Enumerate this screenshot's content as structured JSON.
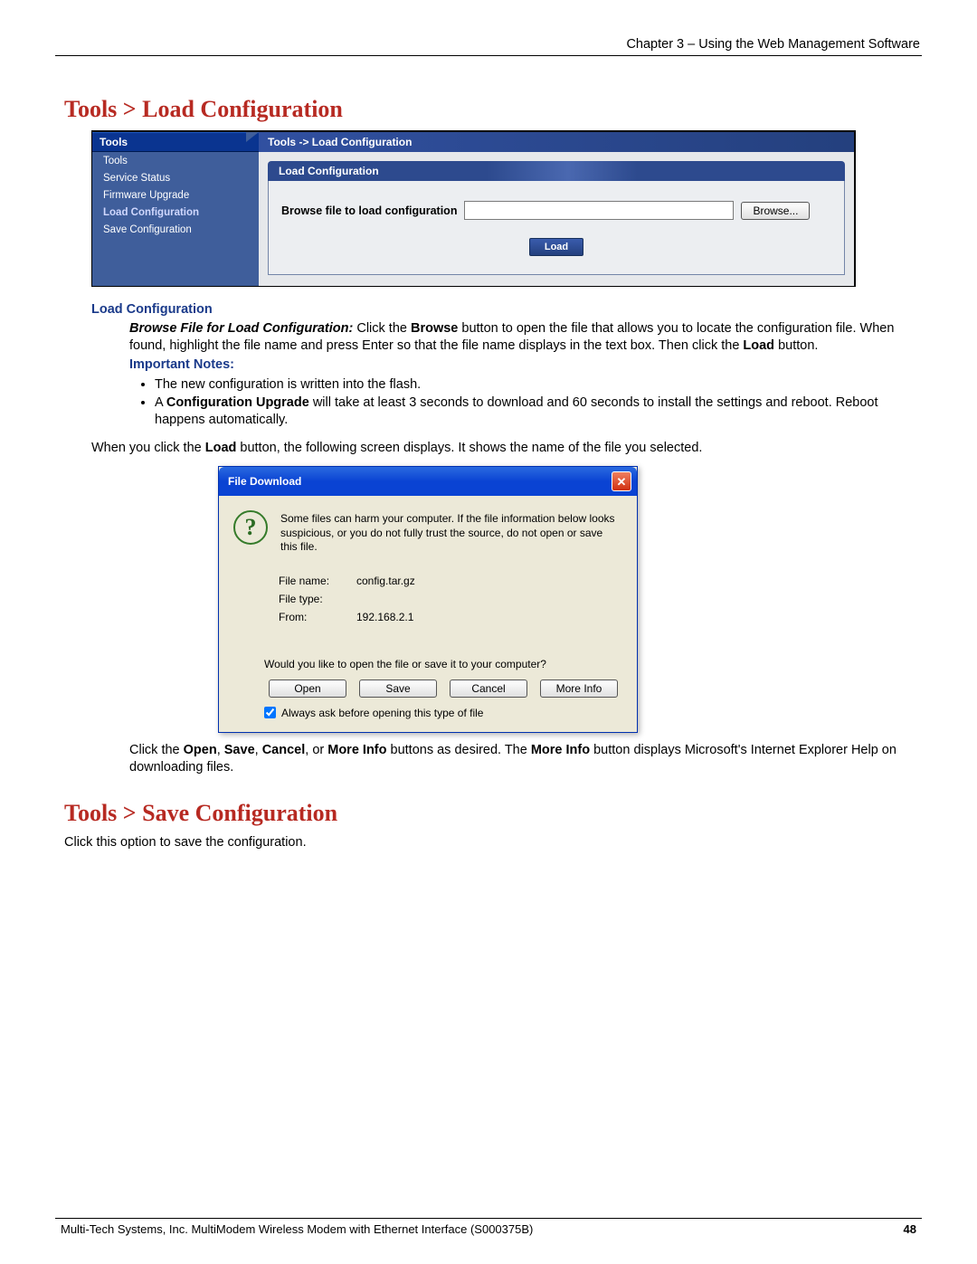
{
  "header": {
    "chapter": "Chapter 3 – Using the Web Management Software"
  },
  "section1": {
    "heading": "Tools > Load Configuration"
  },
  "webui": {
    "sidebar": {
      "tab": "Tools",
      "items": [
        "Tools",
        "Service Status",
        "Firmware Upgrade",
        "Load Configuration",
        "Save Configuration"
      ],
      "active_index": 3
    },
    "crumb": "Tools  ->  Load Configuration",
    "section_title": "Load Configuration",
    "browse_label": "Browse file to load configuration",
    "browse_btn": "Browse...",
    "load_btn": "Load"
  },
  "doc1": {
    "sub1": "Load Configuration",
    "p1_lead": "Browse File for Load Configuration:",
    "p1_rest_a": " Click the ",
    "p1_browse": "Browse",
    "p1_rest_b": " button to open the file that allows you to locate the configuration file. When found, highlight the file name and press Enter so that the file name displays in the text box. Then click the ",
    "p1_load": "Load",
    "p1_rest_c": " button.",
    "sub2": "Important Notes:",
    "bullets": {
      "b1": "The new configuration is written into the flash.",
      "b2_a": "A ",
      "b2_b": "Configuration Upgrade",
      "b2_c": " will take at least 3 seconds to download and 60 seconds to install the settings and reboot. Reboot happens automatically."
    },
    "after_a": "When you click the ",
    "after_load": "Load",
    "after_b": " button, the following screen displays. It shows the name of the file you selected."
  },
  "dialog": {
    "title": "File Download",
    "msg": "Some files can harm your computer. If the file information below looks suspicious, or you do not fully trust the source, do not open or save this file.",
    "filename_lbl": "File name:",
    "filename": "config.tar.gz",
    "filetype_lbl": "File type:",
    "filetype": "",
    "from_lbl": "From:",
    "from": "192.168.2.1",
    "question": "Would you like to open the file or save it to your computer?",
    "btn_open": "Open",
    "btn_save": "Save",
    "btn_cancel": "Cancel",
    "btn_more": "More Info",
    "always_ask": "Always ask before opening this type of file"
  },
  "doc2": {
    "p_a": "Click the ",
    "p_open": "Open",
    "p_s1": ", ",
    "p_save": "Save",
    "p_s2": ", ",
    "p_cancel": "Cancel",
    "p_s3": ", or ",
    "p_more": "More Info",
    "p_b": " buttons as desired. The ",
    "p_more2": "More Info",
    "p_c": " button displays Microsoft's Internet Explorer Help on downloading files."
  },
  "section2": {
    "heading": "Tools > Save Configuration",
    "text": "Click this option to save the configuration."
  },
  "footer": {
    "text": "Multi-Tech Systems, Inc. MultiModem Wireless Modem with Ethernet Interface (S000375B)",
    "page": "48"
  }
}
